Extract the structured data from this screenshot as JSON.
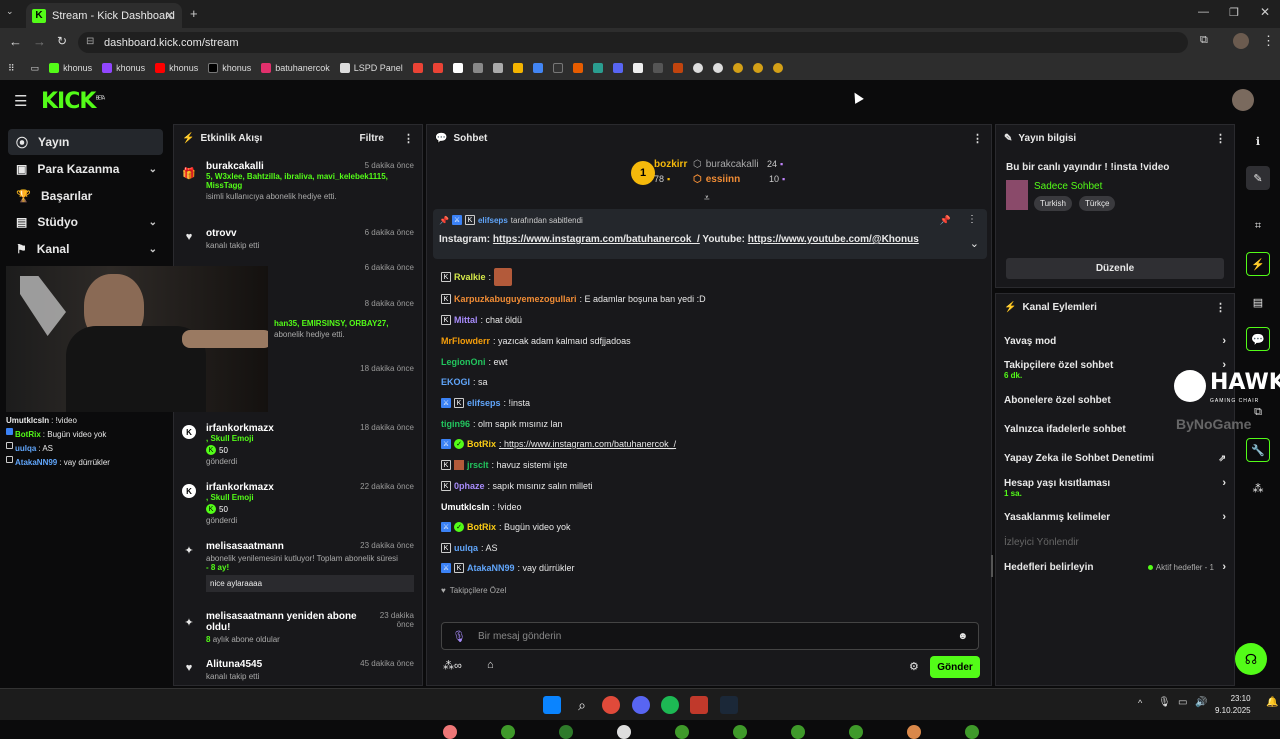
{
  "browser": {
    "tab_title": "Stream - Kick Dashboard",
    "url": "dashboard.kick.com/stream",
    "bookmarks": [
      "khonus",
      "khonus",
      "khonus",
      "khonus",
      "batuhanercok",
      "LSPD Panel"
    ]
  },
  "kick": {
    "logo": "KICK",
    "logo_sup": "BETA",
    "nav": [
      {
        "label": "Yayın",
        "icon": "stream-icon",
        "active": true
      },
      {
        "label": "Para Kazanma",
        "icon": "money-icon",
        "chevron": true
      },
      {
        "label": "Başarılar",
        "icon": "trophy-icon"
      },
      {
        "label": "Stüdyo",
        "icon": "studio-icon",
        "chevron": true
      },
      {
        "label": "Kanal",
        "icon": "channel-icon",
        "chevron": true
      }
    ]
  },
  "overlay_chat": [
    {
      "user": "Umutklcsln",
      "text": ": !video"
    },
    {
      "user": "BotRix",
      "text": ": Bugün video yok"
    },
    {
      "user": "uulqa",
      "text": ": AS"
    },
    {
      "user": "AtakaNN99",
      "text": ": vay dürrükler"
    }
  ],
  "activity": {
    "title": "Etkinlik Akışı",
    "filter": "Filtre",
    "items": [
      {
        "name": "burakcakalli",
        "time": "5 dakika önce",
        "green": "5, W3xlee, Bahtzilla, ibraliva, mavi_kelebek1115, MissTagg",
        "desc": "isimli kullanıcıya abonelik hediye etti."
      },
      {
        "name": "otrovv",
        "time": "6 dakika önce",
        "desc": "kanalı takip etti"
      },
      {
        "time": "6 dakika önce"
      },
      {
        "time": "8 dakika önce",
        "green": "han35, EMIRSINSY, ORBAY27,",
        "desc": "abonelik hediye etti."
      },
      {
        "time": "18 dakika önce"
      },
      {
        "name": "irfankorkmazx",
        "time": "18 dakika önce",
        "green": ", Skull Emoji",
        "amount": "50",
        "desc": "gönderdi"
      },
      {
        "name": "irfankorkmazx",
        "time": "22 dakika önce",
        "green": ", Skull Emoji",
        "amount": "50",
        "desc": "gönderdi"
      },
      {
        "name": "melisasaatmann",
        "time": "23 dakika önce",
        "desc": "abonelik yenilemesini kutluyor! Toplam abonelik süresi",
        "green": "- 8 ay!",
        "quote": "nice aylaraaaa"
      },
      {
        "name": "melisasaatmann yeniden abone oldu!",
        "time": "23 dakika önce",
        "green": "8",
        "desc": "aylık abone oldular"
      },
      {
        "name": "Alituna4545",
        "time": "45 dakika önce",
        "desc": "kanalı takip etti"
      }
    ]
  },
  "chat": {
    "title": "Sohbet",
    "top": [
      {
        "rank": "1",
        "user": "bozkirr",
        "value": "78"
      },
      {
        "user": "burakcakalli",
        "value": "24"
      },
      {
        "user": "essiinn",
        "value": "10"
      }
    ],
    "pinned_by_user": "elifseps",
    "pinned_by_text": "tarafından sabitlendi",
    "pinned_prefix1": "Instagram: ",
    "pinned_link1": "https://www.instagram.com/batuhanercok_/",
    "pinned_prefix2": " Youtube: ",
    "pinned_link2": "https://www.youtube.com/@Khonus",
    "messages": [
      {
        "user": "Rvalkie",
        "text": ":",
        "color": "#d5e84a"
      },
      {
        "user": "Karpuzkabuguyemezogullari",
        "text": ": E adamlar boşuna ban yedi :D",
        "color": "#f08c35"
      },
      {
        "user": "Mittal",
        "text": ": chat öldü",
        "color": "#a78bfa"
      },
      {
        "user": "MrFlowderr",
        "text": ": yazıcak adam kalmaıd sdfjjadoas",
        "color": "#f59e0b"
      },
      {
        "user": "LegionOni",
        "text": ": ewt",
        "color": "#22c55e"
      },
      {
        "user": "EKOGI",
        "text": ": sa",
        "color": "#60a5fa"
      },
      {
        "user": "elifseps",
        "text": ": !insta",
        "color": "#60a5fa"
      },
      {
        "user": "tigin96",
        "text": ": olm sapık mısınız lan",
        "color": "#22c55e"
      },
      {
        "user": "BotRix",
        "text": ": https://www.instagram.com/batuhanercok_/",
        "color": "#facc15"
      },
      {
        "user": "jrsclt",
        "text": ": havuz sistemi işte",
        "color": "#22c55e"
      },
      {
        "user": "0phaze",
        "text": ": sapık mısınız salın milleti",
        "color": "#a78bfa"
      },
      {
        "user": "Umutklcsln",
        "text": ": !video",
        "color": "#ffffff"
      },
      {
        "user": "BotRix",
        "text": ": Bugün video yok",
        "color": "#facc15"
      },
      {
        "user": "uulqa",
        "text": ": AS",
        "color": "#60a5fa"
      },
      {
        "user": "AtakaNN99",
        "text": ": vay dürrükler",
        "color": "#60a5fa"
      }
    ],
    "followers_only": "Takipçilere Özel",
    "placeholder": "Bir mesaj gönderin",
    "send": "Gönder"
  },
  "stream_info": {
    "title": "Yayın bilgisi",
    "stream_title": "Bu bir canlı yayındır ! !insta !video",
    "category": "Sadece Sohbet",
    "tags": [
      "Turkish",
      "Türkçe"
    ],
    "edit": "Düzenle"
  },
  "channel_actions": {
    "title": "Kanal Eylemleri",
    "items": [
      {
        "label": "Yavaş mod",
        "arrow": true
      },
      {
        "label": "Takipçilere özel sohbet",
        "sub": "6 dk.",
        "arrow": true
      },
      {
        "label": "Abonelere özel sohbet"
      },
      {
        "label": "Yalnızca ifadelerle sohbet"
      },
      {
        "label": "Yapay Zeka ile Sohbet Denetimi"
      },
      {
        "label": "Hesap yaşı kısıtlaması",
        "sub": "1 sa.",
        "arrow": true
      },
      {
        "label": "Yasaklanmış kelimeler",
        "arrow": true
      },
      {
        "label": "İzleyici Yönlendir"
      },
      {
        "label": "Hedefleri belirleyin",
        "status": "Aktif hedefler - 1",
        "arrow": true
      }
    ]
  },
  "watermark": {
    "hawk": "HAWK",
    "hawk_sub": "GAMING CHAIR",
    "bynogame": "ByNoGame"
  },
  "taskbar": {
    "time": "23:10",
    "date": "9.10.2025"
  }
}
